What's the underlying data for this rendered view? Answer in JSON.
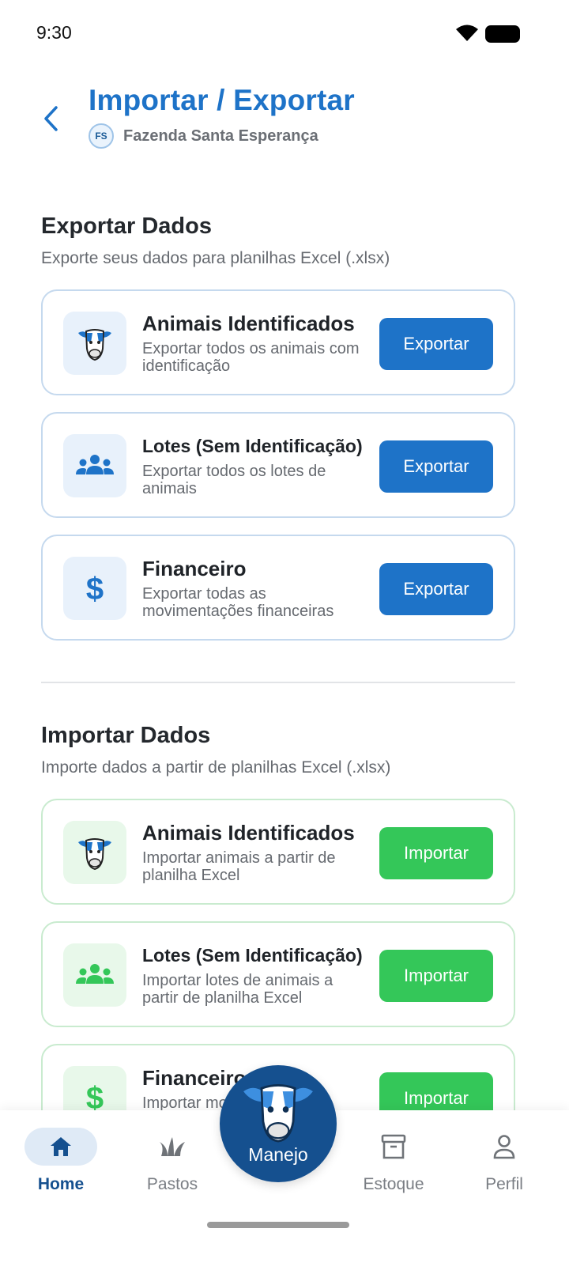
{
  "status_bar": {
    "time": "9:30"
  },
  "header": {
    "title": "Importar / Exportar",
    "farm_initials": "FS",
    "farm_name": "Fazenda Santa Esperança"
  },
  "export_section": {
    "title": "Exportar Dados",
    "subtitle": "Exporte seus dados para planilhas Excel (.xlsx)",
    "cards": [
      {
        "title": "Animais Identificados",
        "desc": "Exportar todos os animais com identificação",
        "button": "Exportar",
        "icon": "cow-icon"
      },
      {
        "title": "Lotes (Sem Identificação)",
        "desc": "Exportar todos os lotes de animais",
        "button": "Exportar",
        "icon": "group-icon"
      },
      {
        "title": "Financeiro",
        "desc": "Exportar todas as movimentações financeiras",
        "button": "Exportar",
        "icon": "dollar-icon"
      }
    ]
  },
  "import_section": {
    "title": "Importar Dados",
    "subtitle": "Importe dados a partir de planilhas Excel (.xlsx)",
    "cards": [
      {
        "title": "Animais Identificados",
        "desc": "Importar animais a partir de planilha Excel",
        "button": "Importar",
        "icon": "cow-icon"
      },
      {
        "title": "Lotes (Sem Identificação)",
        "desc": "Importar lotes de animais a partir de planilha Excel",
        "button": "Importar",
        "icon": "group-icon"
      },
      {
        "title": "Financeiro",
        "desc": "Importar movimentações financeiras",
        "button": "Importar",
        "icon": "dollar-icon"
      }
    ]
  },
  "bottom_nav": {
    "items": [
      {
        "label": "Home",
        "icon": "home-icon",
        "active": true
      },
      {
        "label": "Pastos",
        "icon": "grass-icon"
      },
      {
        "label": "Manejo",
        "icon": "cow-icon"
      },
      {
        "label": "Estoque",
        "icon": "archive-icon"
      },
      {
        "label": "Perfil",
        "icon": "person-icon"
      }
    ]
  },
  "colors": {
    "primary": "#1e73c8",
    "primary_dark": "#15508f",
    "import_green": "#34c759"
  }
}
